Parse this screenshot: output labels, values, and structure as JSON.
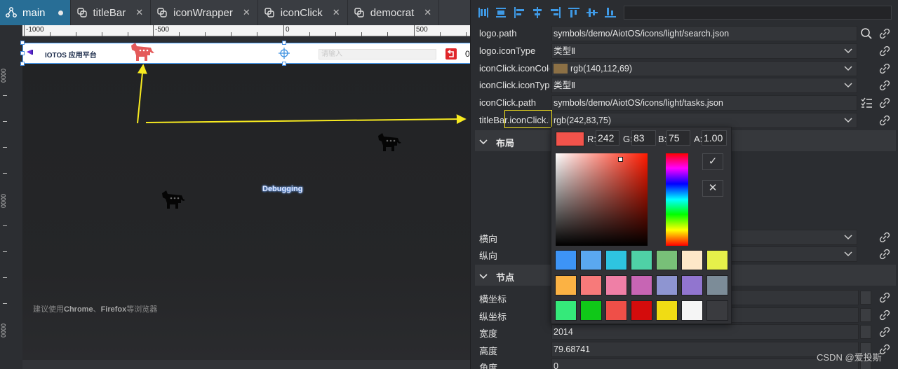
{
  "tabs": [
    {
      "label": "main",
      "active": true,
      "modified": true,
      "icon": "graph-icon"
    },
    {
      "label": "titleBar",
      "active": false,
      "icon": "symbol-icon"
    },
    {
      "label": "iconWrapper",
      "active": false,
      "icon": "symbol-icon"
    },
    {
      "label": "iconClick",
      "active": false,
      "icon": "symbol-icon"
    },
    {
      "label": "democrat",
      "active": false,
      "icon": "symbol-icon"
    }
  ],
  "ruler": {
    "top_labels": [
      "-1000",
      "-500",
      "0",
      "500"
    ],
    "left_labels": [
      "0000",
      "0000",
      "0000"
    ]
  },
  "titlebar": {
    "title": "IOTOS 应用平台",
    "search_placeholder": "请输入",
    "count": "0"
  },
  "canvas": {
    "debugging_label": "Debugging",
    "browser_hint_prefix": "建议使用",
    "browser_hint_chrome": "Chrome",
    "browser_hint_sep": "、",
    "browser_hint_firefox": "Firefox",
    "browser_hint_suffix": "等浏览器"
  },
  "properties": [
    {
      "label": "logo.path",
      "value": "symbols/demo/AiotOS/icons/light/search.json",
      "control": "file",
      "icon": "search-icon"
    },
    {
      "label": "logo.iconType",
      "value": "类型Ⅱ",
      "control": "select"
    },
    {
      "label": "iconClick.iconColor",
      "value": "rgb(140,112,69)",
      "control": "color",
      "swatch": "#8c7045"
    },
    {
      "label": "iconClick.iconType",
      "value": "类型Ⅱ",
      "control": "select"
    },
    {
      "label": "iconClick.path",
      "value": "symbols/demo/AiotOS/icons/light/tasks.json",
      "control": "file",
      "icon": "list-icon"
    },
    {
      "label": "titleBar.iconClick.iconColor",
      "value": "rgb(242,83,75)",
      "control": "color"
    }
  ],
  "sections": {
    "layout": "布局",
    "node": "节点"
  },
  "layout_rows": [
    {
      "label": "横向"
    },
    {
      "label": "纵向"
    }
  ],
  "node_rows": [
    {
      "label": "横坐标",
      "value": ""
    },
    {
      "label": "纵坐标",
      "value": ""
    },
    {
      "label": "宽度",
      "value": "2014"
    },
    {
      "label": "高度",
      "value": "79.68741"
    },
    {
      "label": "角度",
      "value": "0"
    }
  ],
  "picker": {
    "current": "#f2534b",
    "labels": {
      "r": "R:",
      "g": "G:",
      "b": "B:",
      "a": "A:"
    },
    "r": "242",
    "g": "83",
    "b": "75",
    "a": "1.00",
    "ok": "✓",
    "cancel": "✕",
    "swatches": [
      "#3d94f6",
      "#5aa8f0",
      "#2ec4e0",
      "#4fd1a6",
      "#78c078",
      "#fde7c8",
      "#e6f04a",
      "#fbb244",
      "#f77a7a",
      "#ef7fa6",
      "#c765b4",
      "#8e95d1",
      "#9175cf",
      "#7c8c98",
      "#35e97a",
      "#10c818",
      "#ef4f48",
      "#d40c0c",
      "#f0dc14",
      "#f5f5f5",
      "#3a3b3f"
    ]
  },
  "colors": {
    "tab_active": "#286e96",
    "highlight": "#f3e11c",
    "arrow": "#f7ea20",
    "donkey_red": "#e45a5a"
  },
  "watermark": "CSDN @爱投斯"
}
